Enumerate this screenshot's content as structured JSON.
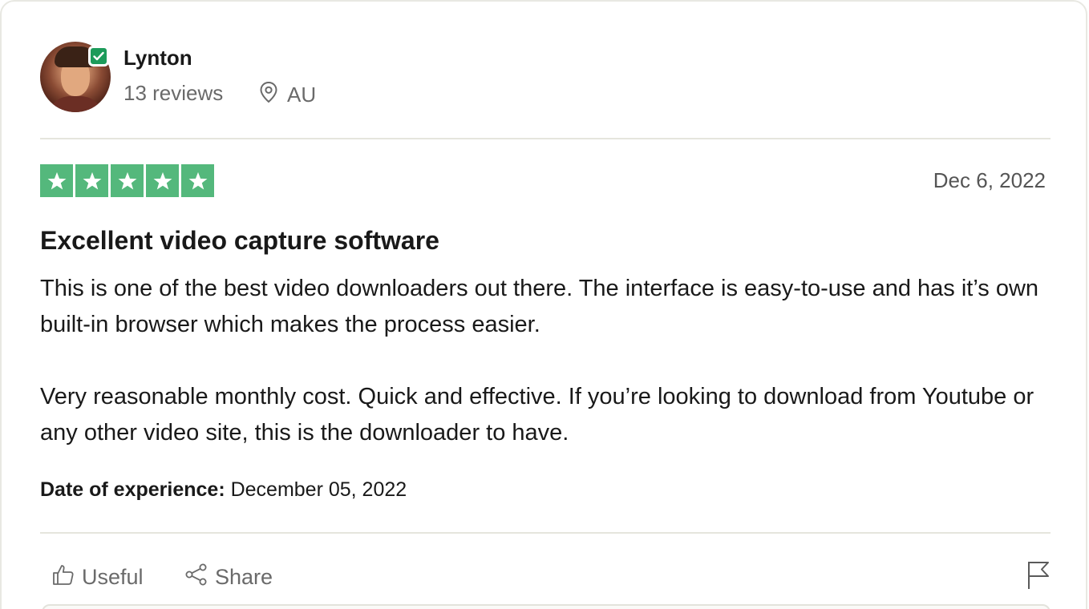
{
  "reviewer": {
    "name": "Lynton",
    "reviews_count": "13 reviews",
    "country": "AU",
    "verified": true
  },
  "review": {
    "rating": 5,
    "rating_max": 5,
    "date": "Dec 6, 2022",
    "title": "Excellent video capture software",
    "body": [
      "This is one of the best video downloaders out there. The interface is easy-to-use and has it’s own built-in browser which makes the process easier.",
      "Very reasonable monthly cost. Quick and effective. If you’re looking to download from Youtube or any other video site, this is the downloader to have."
    ],
    "experience_label": "Date of experience:",
    "experience_date": "December 05, 2022"
  },
  "actions": {
    "useful_label": "Useful",
    "share_label": "Share"
  },
  "icons": {
    "verified": "verified-check-icon",
    "location": "location-pin-icon",
    "star": "star-icon",
    "useful": "thumbs-up-icon",
    "share": "share-icon",
    "report": "flag-icon"
  },
  "colors": {
    "star_green": "#54b87c",
    "verified_green": "#1c9b5a",
    "muted_text": "#6a6a6a",
    "divider": "#e5e5dd"
  }
}
